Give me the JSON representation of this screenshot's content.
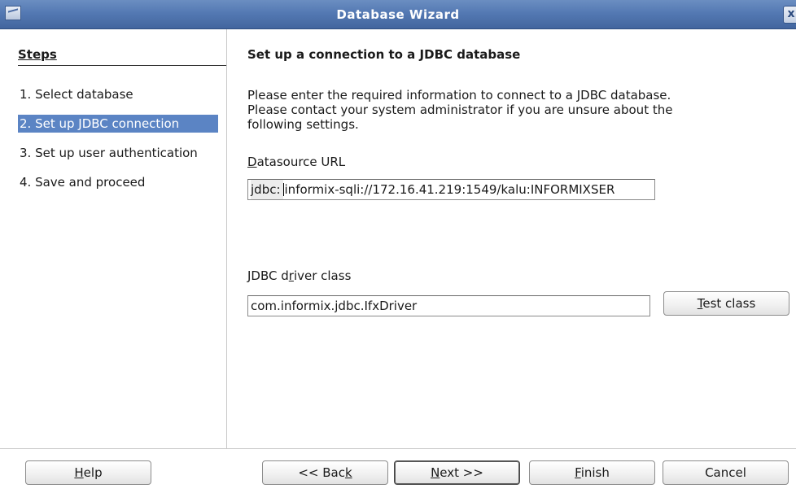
{
  "window": {
    "title": "Database Wizard",
    "close_label": "x"
  },
  "steps": {
    "heading": "Steps",
    "items": [
      {
        "label": "1. Select database",
        "selected": false
      },
      {
        "label": "2. Set up JDBC connection",
        "selected": true
      },
      {
        "label": "3. Set up user authentication",
        "selected": false
      },
      {
        "label": "4. Save and proceed",
        "selected": false
      }
    ]
  },
  "page": {
    "heading": "Set up a connection to a JDBC database",
    "description_lines": [
      "Please enter the required information to connect to a JDBC database.",
      "Please contact your system administrator if you are unsure about the",
      "following settings."
    ],
    "datasource_label_first": "D",
    "datasource_label_rest": "atasource URL",
    "url_prefix": "jdbc:",
    "url_value": "informix-sqli://172.16.41.219:1549/kalu:INFORMIXSER",
    "driver_label_a": "JDBC d",
    "driver_label_u": "r",
    "driver_label_b": "iver class",
    "driver_value": "com.informix.jdbc.IfxDriver",
    "test_class_u": "T",
    "test_class_rest": "est class"
  },
  "buttons": {
    "help_u": "H",
    "help_rest": "elp",
    "back_a": "<< Bac",
    "back_u": "k",
    "next_u": "N",
    "next_rest": "ext >>",
    "finish_u": "F",
    "finish_rest": "inish",
    "cancel": "Cancel"
  },
  "colors": {
    "titlebar": "#5479b3",
    "selection": "#5b84c4"
  }
}
